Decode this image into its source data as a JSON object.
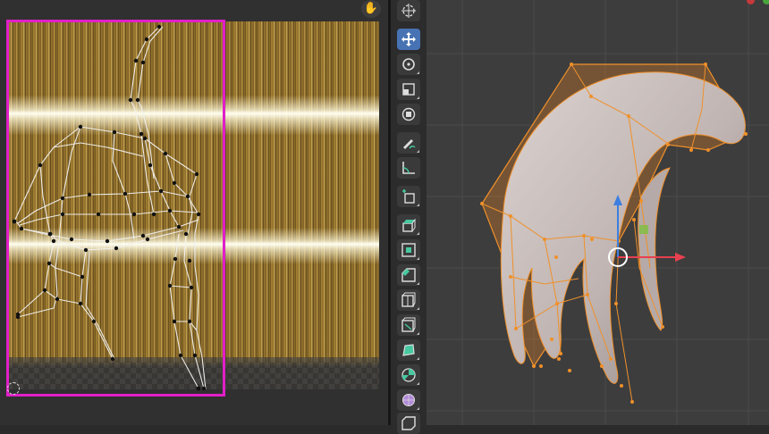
{
  "uv_editor": {
    "hand_icon": "hand-icon",
    "selection_color": "#e01fc8"
  },
  "toolbar": {
    "tools": [
      {
        "name": "cursor-tool",
        "icon": "cursor-icon",
        "active": false
      },
      {
        "name": "move-tool",
        "icon": "move-icon",
        "active": true
      },
      {
        "name": "rotate-tool",
        "icon": "rotate-icon",
        "active": false
      },
      {
        "name": "scale-tool",
        "icon": "scale-icon",
        "active": false
      },
      {
        "name": "transform-tool",
        "icon": "transform-icon",
        "active": false
      },
      {
        "name": "annotate-tool",
        "icon": "annotate-icon",
        "active": false
      },
      {
        "name": "measure-tool",
        "icon": "measure-icon",
        "active": false
      },
      {
        "name": "add-cube-tool",
        "icon": "add-cube-icon",
        "active": false
      },
      {
        "name": "extrude-tool",
        "icon": "extrude-icon",
        "active": false
      },
      {
        "name": "inset-tool",
        "icon": "inset-icon",
        "active": false
      },
      {
        "name": "bevel-tool",
        "icon": "bevel-icon",
        "active": false
      },
      {
        "name": "loop-cut-tool",
        "icon": "loop-cut-icon",
        "active": false
      },
      {
        "name": "knife-tool",
        "icon": "knife-icon",
        "active": false
      },
      {
        "name": "poly-build-tool",
        "icon": "poly-build-icon",
        "active": false
      },
      {
        "name": "spin-tool",
        "icon": "spin-icon",
        "active": false
      },
      {
        "name": "smooth-tool",
        "icon": "smooth-icon",
        "active": false
      },
      {
        "name": "shear-tool",
        "icon": "shear-icon",
        "active": false
      }
    ],
    "accent": "#4772b3"
  },
  "viewport": {
    "mesh_color": "#f0902a",
    "surface_color": "#c9bfbd",
    "gizmo_colors": {
      "x": "#e8404f",
      "z": "#3d7fe0",
      "y": "#7fbf3f"
    }
  }
}
